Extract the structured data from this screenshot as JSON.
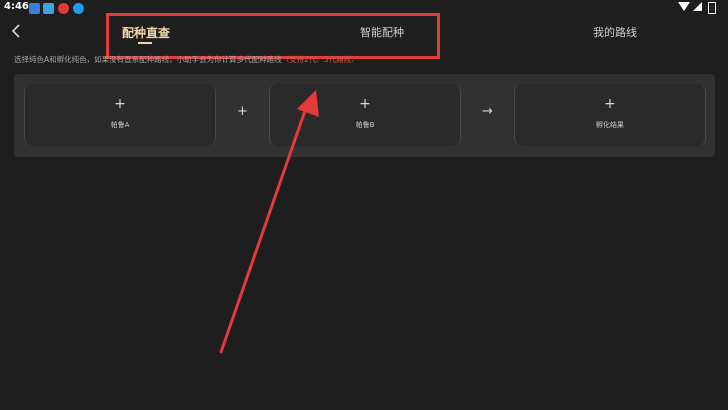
{
  "status_bar": {
    "time": "4:46",
    "notification_icons": [
      "bird-icon",
      "cat-icon",
      "antivirus-icon",
      "anchor-icon"
    ],
    "system_icons": [
      "wifi-icon",
      "signal-icon",
      "battery-icon"
    ]
  },
  "nav": {
    "back_icon": "chevron-left-icon",
    "tabs": [
      {
        "label": "配种直查",
        "active": true
      },
      {
        "label": "智能配种",
        "active": false
      },
      {
        "label": "我的路线",
        "active": false
      }
    ]
  },
  "hint": {
    "text": "选择纯色A和孵化纯色，如果没有直系配种路线，小助手会为你计算多代配种路线",
    "highlight": "（支持2代、3代路线）"
  },
  "breeding": {
    "parent_a_label": "帕鲁A",
    "parent_b_label": "帕鲁B",
    "result_label": "孵化结果",
    "plus_symbol": "+",
    "operator_plus": "+",
    "operator_arrow": "→"
  },
  "annotation": {
    "color": "#e33b3b"
  }
}
